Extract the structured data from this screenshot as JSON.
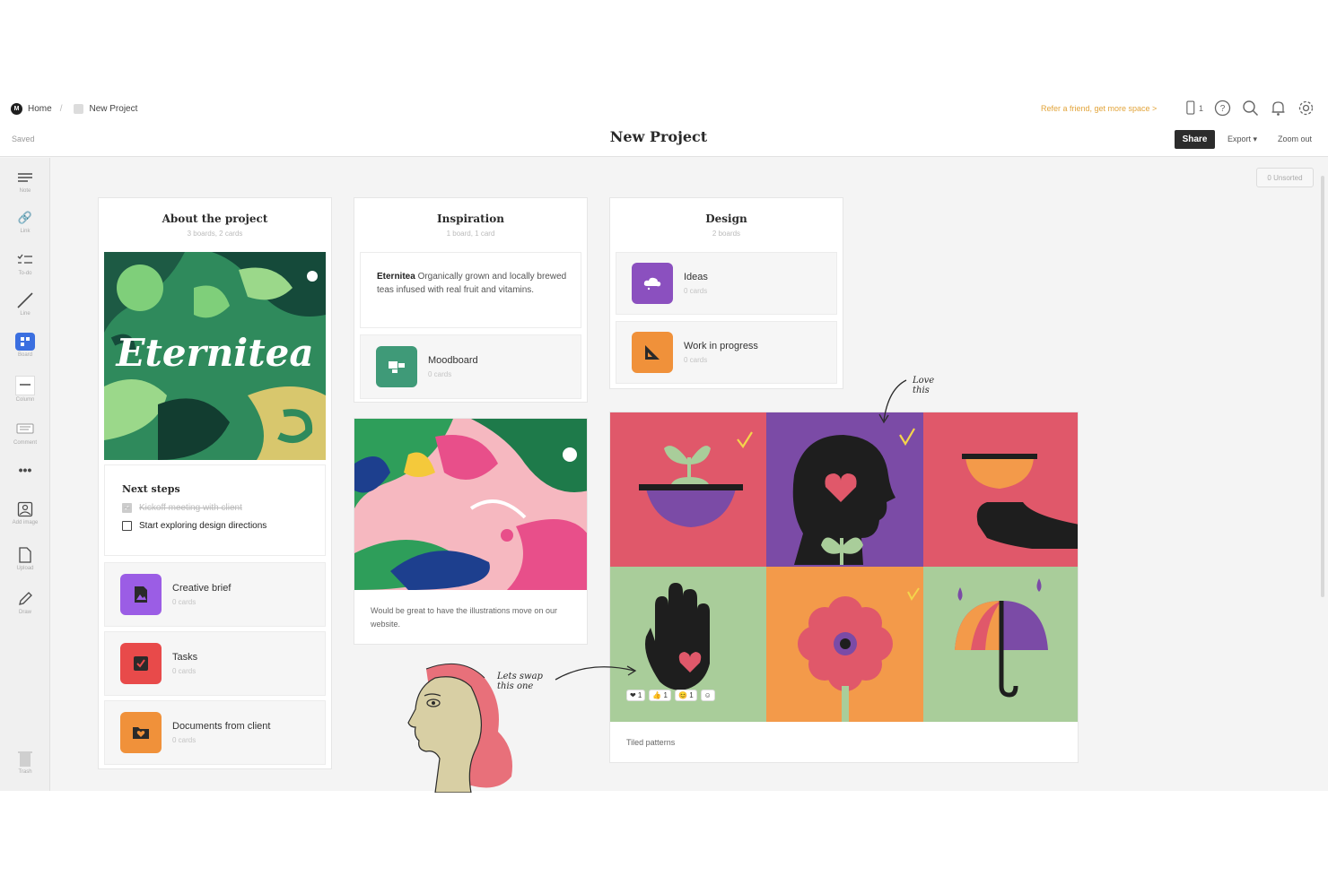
{
  "header": {
    "home_label": "Home",
    "project_crumb": "New Project",
    "saved_status": "Saved",
    "title": "New Project",
    "refer_link": "Refer a friend, get more space >",
    "device_count": "1",
    "share_label": "Share",
    "export_label": "Export",
    "zoom_label": "Zoom out"
  },
  "toolbar": {
    "items": [
      {
        "label": "Note",
        "icon": "note-icon"
      },
      {
        "label": "Link",
        "icon": "link-icon"
      },
      {
        "label": "To-do",
        "icon": "todo-icon"
      },
      {
        "label": "Line",
        "icon": "line-icon"
      },
      {
        "label": "Board",
        "icon": "board-icon"
      },
      {
        "label": "Column",
        "icon": "column-icon"
      },
      {
        "label": "Comment",
        "icon": "comment-icon"
      },
      {
        "label": "Add image",
        "icon": "image-icon"
      },
      {
        "label": "Upload",
        "icon": "upload-icon"
      },
      {
        "label": "Draw",
        "icon": "draw-icon"
      },
      {
        "label": "Trash",
        "icon": "trash-icon"
      }
    ]
  },
  "canvas": {
    "unsorted_label": "0 Unsorted",
    "about": {
      "title": "About the project",
      "subtitle": "3 boards, 2 cards",
      "image_text": "Eternitea",
      "next_steps_title": "Next steps",
      "todos": [
        {
          "text": "Kickoff meeting with client",
          "done": true
        },
        {
          "text": "Start exploring design directions",
          "done": false
        }
      ],
      "boards": [
        {
          "name": "Creative brief",
          "count": "0 cards",
          "color": "#9b5de5"
        },
        {
          "name": "Tasks",
          "count": "0 cards",
          "color": "#e84a4a"
        },
        {
          "name": "Documents from client",
          "count": "0 cards",
          "color": "#f0913a"
        }
      ]
    },
    "inspiration": {
      "title": "Inspiration",
      "subtitle": "1 board, 1 card",
      "note_bold": "Eternitea",
      "note_text": "Organically grown and locally brewed teas infused with real fruit and vitamins.",
      "board": {
        "name": "Moodboard",
        "count": "0 cards",
        "color": "#3f9a78"
      },
      "image_caption": "Would be great to have the illustrations move on our website."
    },
    "design": {
      "title": "Design",
      "subtitle": "2 boards",
      "boards": [
        {
          "name": "Ideas",
          "count": "0 cards",
          "color": "#8b50bf"
        },
        {
          "name": "Work in progress",
          "count": "0 cards",
          "color": "#f0913a"
        }
      ]
    },
    "patterns": {
      "caption": "Tiled patterns",
      "reactions": [
        "❤ 1",
        "👍 1",
        "😊 1",
        "☺"
      ]
    },
    "annotations": {
      "love_this": "Love this",
      "lets_swap": "Lets swap this one"
    },
    "colors": {
      "accent": "#3b6fe0",
      "tile_red": "#e0586a",
      "tile_purple": "#7b4ba6",
      "tile_green": "#a9cd9a",
      "tile_orange": "#f39a4a"
    }
  }
}
